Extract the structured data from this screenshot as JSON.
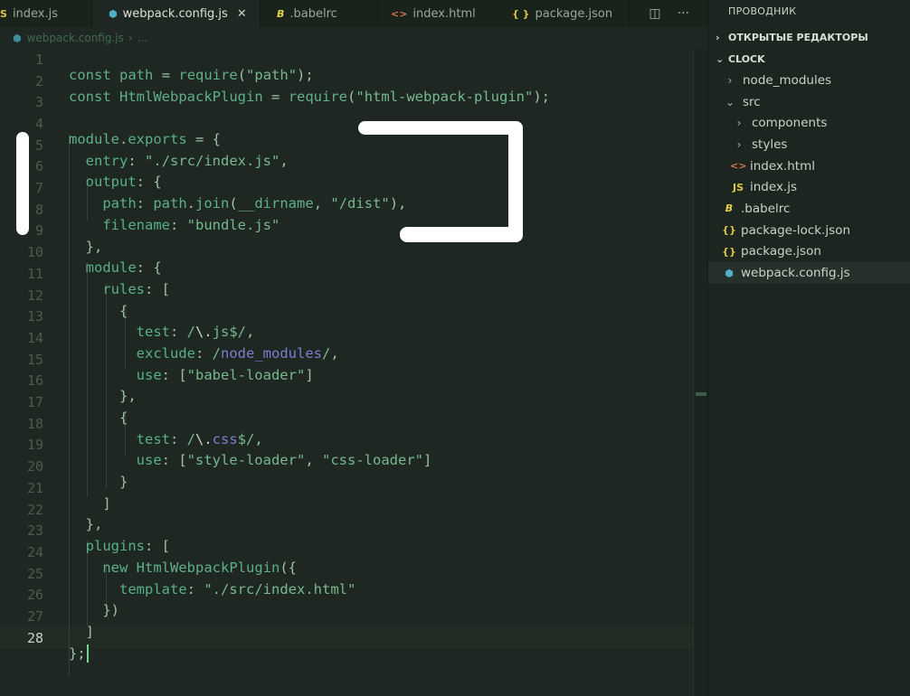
{
  "tabs": [
    {
      "label": "index.js",
      "icon": "js-icon",
      "icon_text": "JS",
      "active": false
    },
    {
      "label": "webpack.config.js",
      "icon": "webpack-icon",
      "icon_text": "⬢",
      "active": true
    },
    {
      "label": ".babelrc",
      "icon": "babel-icon",
      "icon_text": "B",
      "active": false
    },
    {
      "label": "index.html",
      "icon": "html-icon",
      "icon_text": "<>",
      "active": false
    },
    {
      "label": "package.json",
      "icon": "json-icon",
      "icon_text": "{}",
      "active": false
    }
  ],
  "breadcrumb": {
    "file": "webpack.config.js",
    "rest": "..."
  },
  "editor": {
    "current_line": 28,
    "lines": [
      "1",
      "2",
      "3",
      "4",
      "5",
      "6",
      "7",
      "8",
      "9",
      "10",
      "11",
      "12",
      "13",
      "14",
      "15",
      "16",
      "17",
      "18",
      "19",
      "20",
      "21",
      "22",
      "23",
      "24",
      "25",
      "26",
      "27",
      "28"
    ]
  },
  "explorer": {
    "title": "ПРОВОДНИК",
    "open_editors": "ОТКРЫТЫЕ РЕДАКТОРЫ",
    "project": "CLOCK",
    "items": [
      {
        "label": "node_modules",
        "type": "folder",
        "depth": 1
      },
      {
        "label": "src",
        "type": "folder-open",
        "depth": 1
      },
      {
        "label": "components",
        "type": "folder",
        "depth": 2
      },
      {
        "label": "styles",
        "type": "folder",
        "depth": 2
      },
      {
        "label": "index.html",
        "type": "html",
        "depth": 2
      },
      {
        "label": "index.js",
        "type": "js",
        "depth": 2
      },
      {
        "label": ".babelrc",
        "type": "babel",
        "depth": 1
      },
      {
        "label": "package-lock.json",
        "type": "json",
        "depth": 1
      },
      {
        "label": "package.json",
        "type": "json",
        "depth": 1
      },
      {
        "label": "webpack.config.js",
        "type": "webpack",
        "depth": 1,
        "selected": true
      }
    ]
  }
}
